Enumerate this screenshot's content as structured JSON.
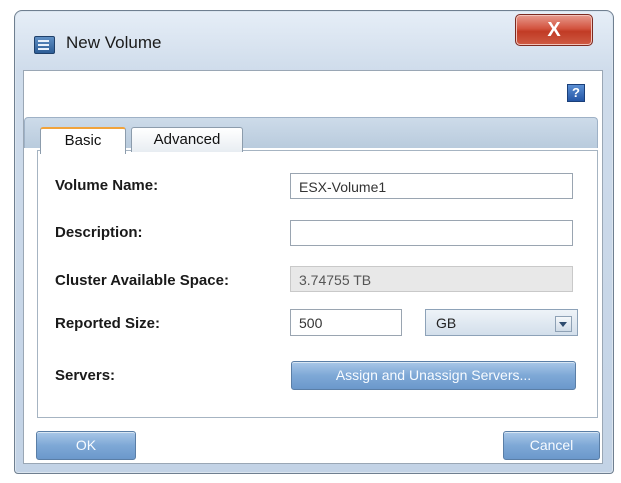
{
  "window": {
    "title": "New Volume",
    "close_label": "X"
  },
  "help": {
    "label": "?"
  },
  "tabs": [
    {
      "label": "Basic"
    },
    {
      "label": "Advanced"
    }
  ],
  "form": {
    "volume_name": {
      "label": "Volume Name:",
      "value": "ESX-Volume1"
    },
    "description": {
      "label": "Description:",
      "value": ""
    },
    "cluster_space": {
      "label": "Cluster Available Space:",
      "value": "3.74755 TB"
    },
    "reported_size": {
      "label": "Reported Size:",
      "value": "500",
      "unit": "GB"
    },
    "servers": {
      "label": "Servers:",
      "button": "Assign and Unassign Servers..."
    }
  },
  "footer": {
    "ok_label": "OK",
    "cancel_label": "Cancel"
  }
}
